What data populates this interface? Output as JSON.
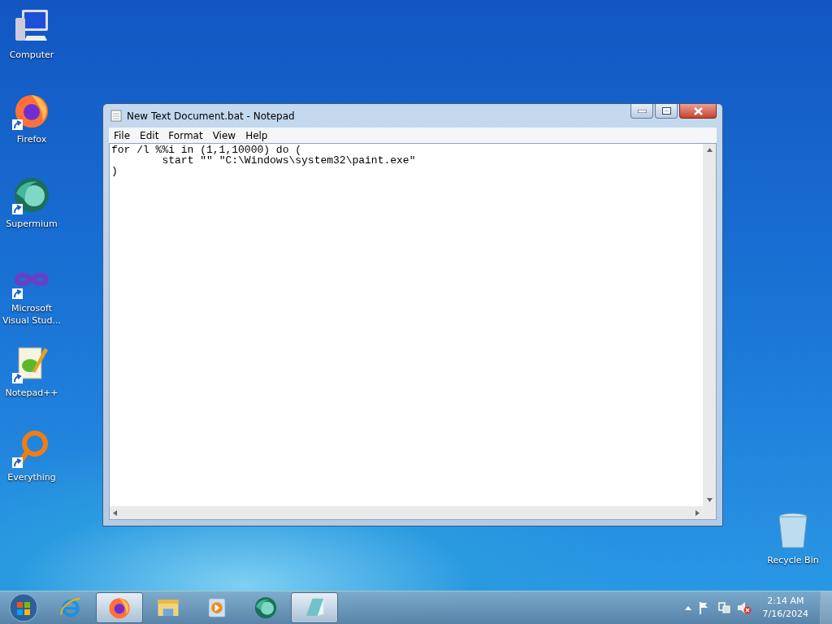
{
  "desktop_icons": [
    {
      "label": "Computer",
      "kind": "computer",
      "shortcut": false
    },
    {
      "label": "Firefox",
      "kind": "firefox",
      "shortcut": true
    },
    {
      "label": "Supermium",
      "kind": "supermium",
      "shortcut": true
    },
    {
      "label": "Microsoft Visual Stud...",
      "kind": "vs",
      "shortcut": true
    },
    {
      "label": "Notepad++",
      "kind": "notepadpp",
      "shortcut": true
    },
    {
      "label": "Everything",
      "kind": "everything",
      "shortcut": true
    }
  ],
  "recycle_bin": {
    "label": "Recycle Bin"
  },
  "window": {
    "title": "New Text Document.bat - Notepad",
    "menu": [
      "File",
      "Edit",
      "Format",
      "View",
      "Help"
    ],
    "text_lines": [
      "for /l %%i in (1,1,10000) do (",
      "\tstart \"\" \"C:\\Windows\\system32\\paint.exe\"",
      ")"
    ]
  },
  "taskbar": {
    "items": [
      {
        "kind": "ie",
        "running": false
      },
      {
        "kind": "firefox",
        "running": true
      },
      {
        "kind": "explorer",
        "running": false
      },
      {
        "kind": "media",
        "running": false
      },
      {
        "kind": "supermium",
        "running": false
      },
      {
        "kind": "notepad",
        "running": true
      }
    ],
    "clock": {
      "time": "2:14 AM",
      "date": "7/16/2024"
    }
  }
}
